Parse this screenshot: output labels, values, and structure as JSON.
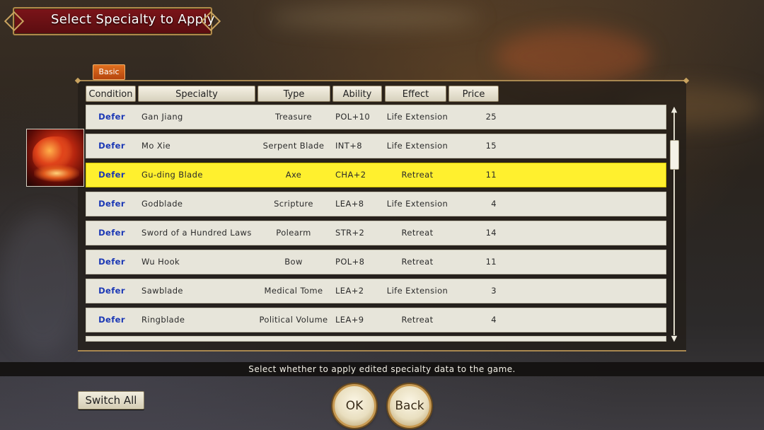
{
  "title": "Select Specialty to Apply",
  "tab": "Basic",
  "columns": {
    "condition": "Condition",
    "specialty": "Specialty",
    "type": "Type",
    "ability": "Ability",
    "effect": "Effect",
    "price": "Price"
  },
  "rows": [
    {
      "condition": "Defer",
      "specialty": "Gan Jiang",
      "type": "Treasure",
      "ability": "POL+10",
      "effect": "Life Extension",
      "price": "25",
      "selected": false
    },
    {
      "condition": "Defer",
      "specialty": "Mo Xie",
      "type": "Serpent Blade",
      "ability": "INT+8",
      "effect": "Life Extension",
      "price": "15",
      "selected": false
    },
    {
      "condition": "Defer",
      "specialty": "Gu-ding Blade",
      "type": "Axe",
      "ability": "CHA+2",
      "effect": "Retreat",
      "price": "11",
      "selected": true
    },
    {
      "condition": "Defer",
      "specialty": "Godblade",
      "type": "Scripture",
      "ability": "LEA+8",
      "effect": "Life Extension",
      "price": "4",
      "selected": false
    },
    {
      "condition": "Defer",
      "specialty": "Sword of a Hundred Laws",
      "type": "Polearm",
      "ability": "STR+2",
      "effect": "Retreat",
      "price": "14",
      "selected": false
    },
    {
      "condition": "Defer",
      "specialty": "Wu Hook",
      "type": "Bow",
      "ability": "POL+8",
      "effect": "Retreat",
      "price": "11",
      "selected": false
    },
    {
      "condition": "Defer",
      "specialty": "Sawblade",
      "type": "Medical Tome",
      "ability": "LEA+2",
      "effect": "Life Extension",
      "price": "3",
      "selected": false
    },
    {
      "condition": "Defer",
      "specialty": "Ringblade",
      "type": "Political Volume",
      "ability": "LEA+9",
      "effect": "Retreat",
      "price": "4",
      "selected": false
    }
  ],
  "message": "Select whether to apply edited specialty data to the game.",
  "buttons": {
    "switch_all": "Switch All",
    "ok": "OK",
    "back": "Back"
  },
  "colors": {
    "selected_row": "#fff02e",
    "condition_text": "#1a37b5",
    "title_banner": "#7b1419"
  }
}
